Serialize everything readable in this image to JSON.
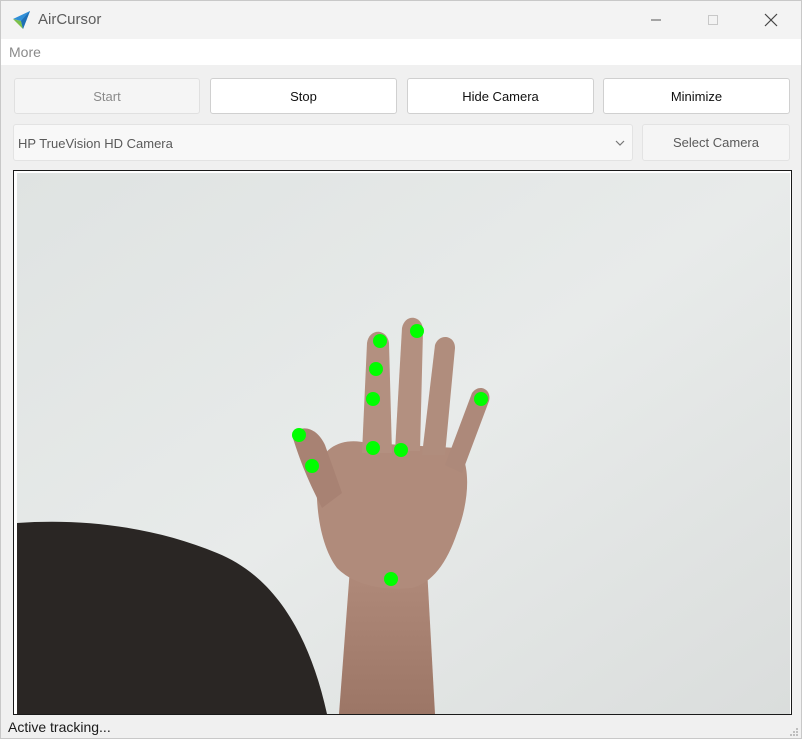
{
  "window": {
    "title": "AirCursor",
    "icon": "paper-plane-icon"
  },
  "menu": {
    "items": [
      "More"
    ]
  },
  "toolbar": {
    "start_label": "Start",
    "stop_label": "Stop",
    "hide_camera_label": "Hide Camera",
    "minimize_label": "Minimize"
  },
  "camera": {
    "selected": "HP TrueVision HD Camera",
    "select_label": "Select Camera"
  },
  "status": {
    "text": "Active tracking..."
  },
  "colors": {
    "landmark": "#00ff00",
    "accent": "#2f8fd8"
  }
}
